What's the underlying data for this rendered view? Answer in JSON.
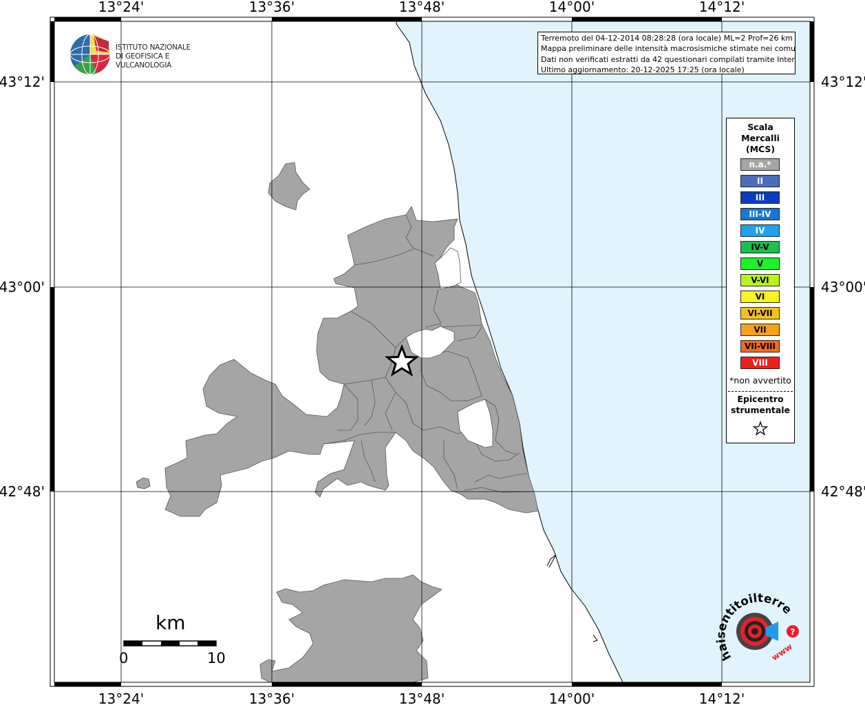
{
  "map": {
    "lon_labels": [
      "13°24'",
      "13°36'",
      "13°48'",
      "14°00'",
      "14°12'"
    ],
    "lat_labels": [
      "43°12'",
      "43°00'",
      "42°48'"
    ],
    "colors": {
      "sea": "#e1f3fd",
      "land": "#ffffff",
      "municipality": "#a5a5a5",
      "border": "#555555"
    }
  },
  "logo": {
    "line1": "ISTITUTO NAZIONALE",
    "line2": "DI GEOFISICA E VULCANOLOGIA"
  },
  "info": {
    "line1": "Terremoto del 04-12-2014 08:28:28 (ora locale) ML=2 Prof=26 km",
    "line2": "Mappa preliminare delle intensità macrosismiche stimate nei comuni",
    "line3": "Dati non verificati estratti da 42 questionari compilati tramite Internet.",
    "line4": "Ultimo aggiornamento: 20-12-2025 17:25 (ora locale)"
  },
  "legend": {
    "title1": "Scala",
    "title2": "Mercalli",
    "title3": "(MCS)",
    "items": [
      {
        "label": "n.a.*",
        "color": "#a5a5a5",
        "text": "#ffffff"
      },
      {
        "label": "II",
        "color": "#4c6bbd",
        "text": "#ffffff"
      },
      {
        "label": "III",
        "color": "#0d3cc0",
        "text": "#ffffff"
      },
      {
        "label": "III-IV",
        "color": "#1677da",
        "text": "#ffffff"
      },
      {
        "label": "IV",
        "color": "#1ea3ee",
        "text": "#ffffff"
      },
      {
        "label": "IV-V",
        "color": "#1dc04d",
        "text": "#000000"
      },
      {
        "label": "V",
        "color": "#1ef029",
        "text": "#000000"
      },
      {
        "label": "V-VI",
        "color": "#b7f41d",
        "text": "#000000"
      },
      {
        "label": "VI",
        "color": "#f5f51c",
        "text": "#000000"
      },
      {
        "label": "VI-VII",
        "color": "#f5c21c",
        "text": "#000000"
      },
      {
        "label": "VII",
        "color": "#f5a11c",
        "text": "#000000"
      },
      {
        "label": "VII-VIII",
        "color": "#f56a1c",
        "text": "#000000"
      },
      {
        "label": "VIII",
        "color": "#f51c1c",
        "text": "#ffffff"
      }
    ],
    "note": "*non avvertito",
    "epi1": "Epicentro",
    "epi2": "strumentale"
  },
  "scale_bar": {
    "unit": "km",
    "start": "0",
    "end": "10"
  },
  "haisentito": {
    "text": "haisentitoilterremoto.it",
    "www": "www"
  }
}
